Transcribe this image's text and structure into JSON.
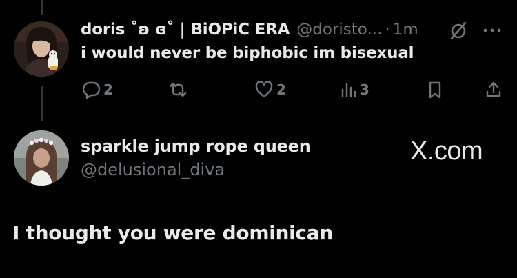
{
  "tweet": {
    "display_name": "doris ˚ʚ ɞ˚ | BiOPiC ERA",
    "handle": "@doristo...",
    "separator": "·",
    "time": "1m",
    "text": "i would never be biphobic im bisexual",
    "stats": {
      "replies": "2",
      "likes": "2",
      "views": "3"
    }
  },
  "reply": {
    "display_name": "sparkle jump rope queen",
    "handle": "@delusional_diva",
    "text": "I thought you were dominican"
  },
  "watermark": "X.com",
  "colors": {
    "background": "#000000",
    "primary_text": "#e7e9ea",
    "secondary_text": "#71767b",
    "thread_line": "#333639"
  },
  "icons": [
    "reply-icon",
    "retweet-icon",
    "like-icon",
    "views-icon",
    "bookmark-icon",
    "share-icon",
    "mute-icon",
    "more-icon"
  ]
}
